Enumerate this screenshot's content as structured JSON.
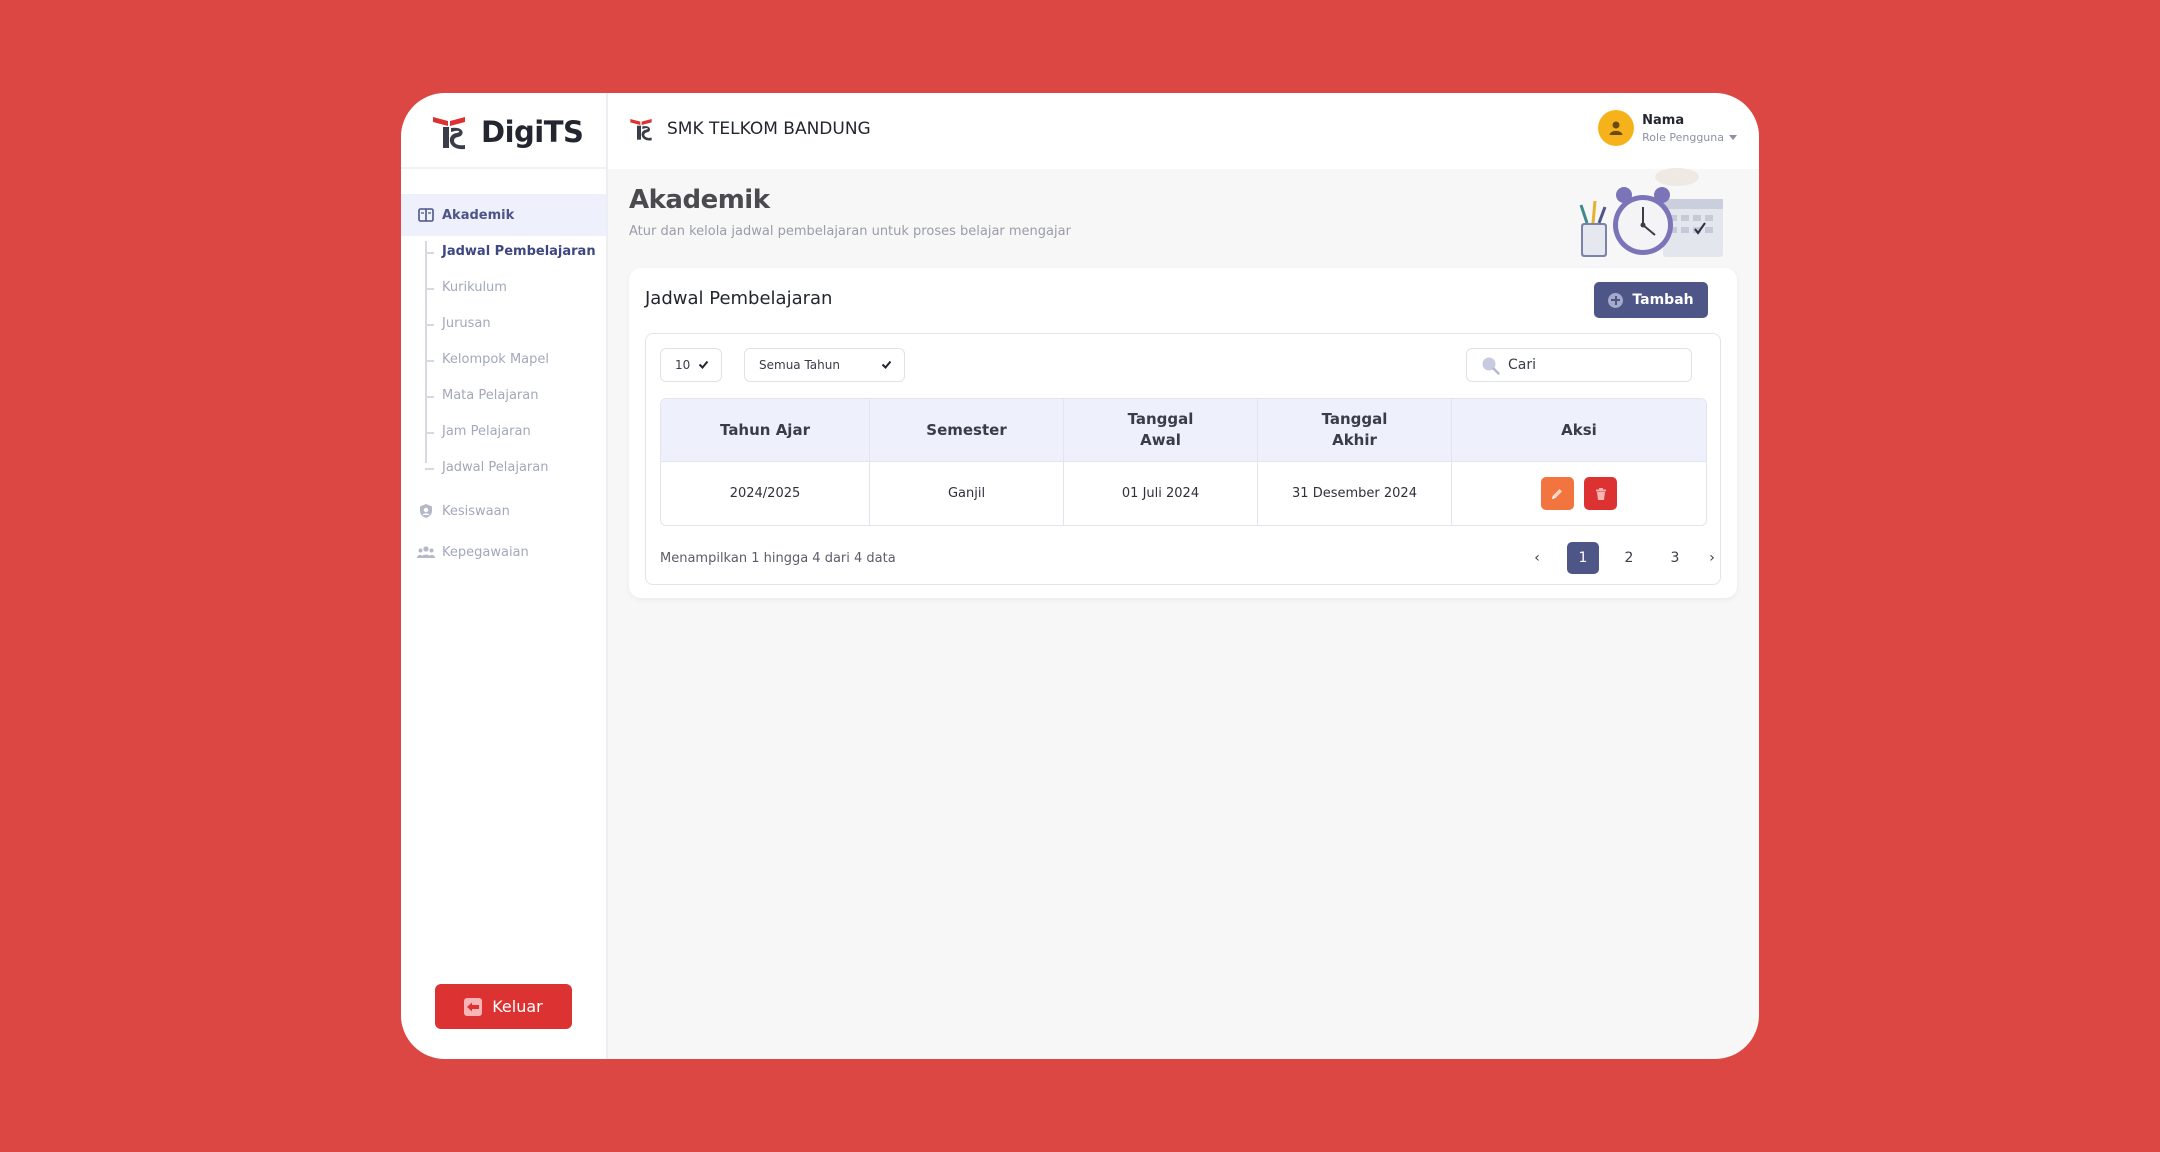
{
  "brand": {
    "name": "DigiTS"
  },
  "header": {
    "school": "SMK TELKOM BANDUNG",
    "user_name": "Nama",
    "user_role": "Role Pengguna"
  },
  "sidebar": {
    "groups": [
      {
        "label": "Akademik",
        "icon": "book-icon",
        "active": true
      },
      {
        "label": "Kesiswaan",
        "icon": "student-badge-icon"
      },
      {
        "label": "Kepegawaian",
        "icon": "staff-group-icon"
      }
    ],
    "subitems": [
      "Jadwal Pembelajaran",
      "Kurikulum",
      "Jurusan",
      "Kelompok Mapel",
      "Mata Pelajaran",
      "Jam Pelajaran",
      "Jadwal Pelajaran"
    ],
    "logout_label": "Keluar"
  },
  "page": {
    "title": "Akademik",
    "subtitle": "Atur dan kelola jadwal pembelajaran untuk proses belajar mengajar"
  },
  "card": {
    "title": "Jadwal Pembelajaran",
    "add_label": "Tambah",
    "page_size": "10",
    "year_filter": "Semua Tahun",
    "search_placeholder": "Cari",
    "columns": [
      "Tahun Ajar",
      "Semester",
      "Tanggal Awal",
      "Tanggal Akhir",
      "Aksi"
    ],
    "rows": [
      {
        "tahun": "2024/2025",
        "semester": "Ganjil",
        "awal": "01 Juli 2024",
        "akhir": "31 Desember 2024"
      }
    ],
    "info": "Menampilkan 1 hingga 4 dari 4 data",
    "pagination": {
      "prev": "‹",
      "pages": [
        "1",
        "2",
        "3"
      ],
      "next": "›",
      "current": "1"
    }
  },
  "colors": {
    "background": "#DC4744",
    "primary": "#4E5587",
    "danger": "#DC3232",
    "edit": "#F2743E",
    "avatar": "#F6B21A"
  }
}
